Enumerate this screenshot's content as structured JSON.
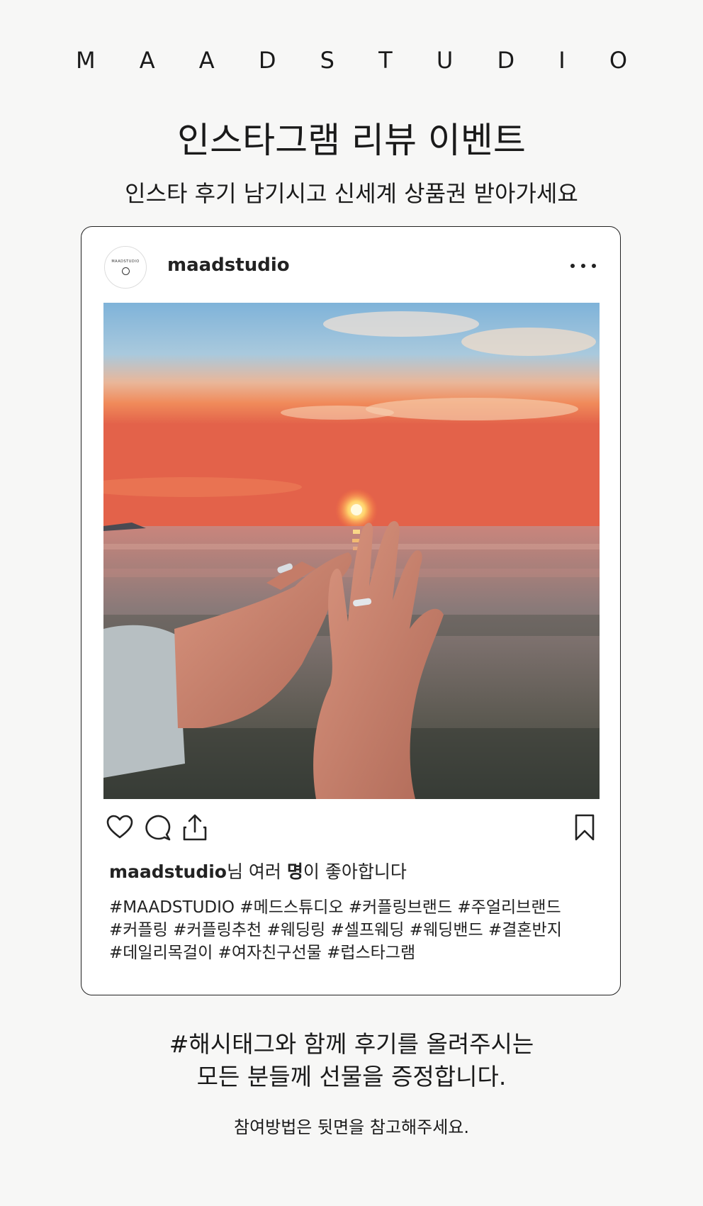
{
  "brand": "M A A D S T U D I O",
  "title": "인스타그램 리뷰 이벤트",
  "subtitle": "인스타 후기 남기시고 신세계 상품권 받아가세요",
  "post": {
    "avatar_text": "MAADSTUDIO",
    "username": "maadstudio",
    "image_alt": "Couple hands with rings at sunset by the sea",
    "likes_user": "maadstudio",
    "likes_mid": "님 여러 ",
    "likes_bold": "명",
    "likes_tail": "이 좋아합니다",
    "hashtags": [
      "#MAADSTUDIO #메드스튜디오 #커플링브랜드 #주얼리브랜드",
      "#커플링  #커플링추천 #웨딩링 #셀프웨딩 #웨딩밴드 #결혼반지",
      "#데일리목걸이 #여자친구선물 #럽스타그램"
    ]
  },
  "cta": {
    "line1": "#해시태그와 함께 후기를 올려주시는",
    "line2": "모든 분들께 선물을 증정합니다."
  },
  "note": "참여방법은 뒷면을 참고해주세요.",
  "icons": [
    "heart-icon",
    "comment-icon",
    "share-icon",
    "bookmark-icon",
    "more-icon"
  ]
}
